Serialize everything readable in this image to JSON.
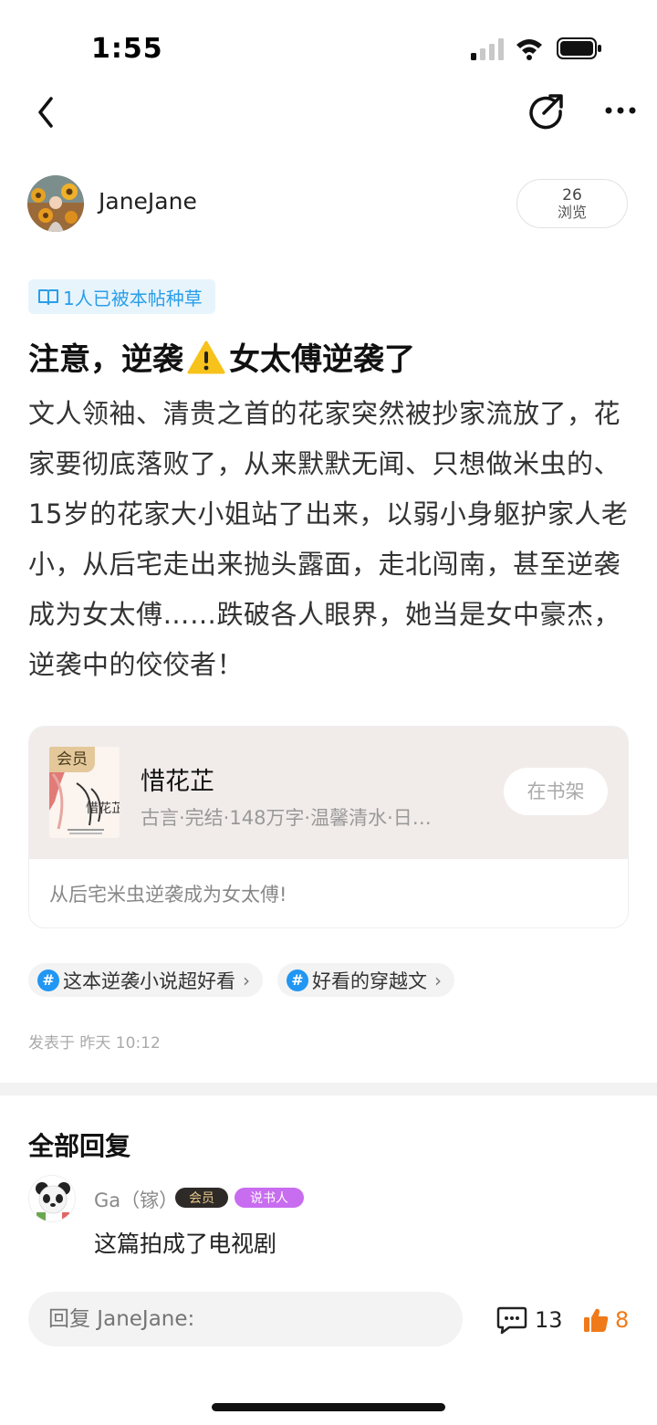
{
  "status_bar": {
    "time": "1:55"
  },
  "author": {
    "name": "JaneJane",
    "views_count": "26",
    "views_label": "浏览"
  },
  "seed_badge": {
    "text": "1人已被本帖种草",
    "icon": "book-icon"
  },
  "post": {
    "title_part1": "注意，逆袭",
    "title_part2": "女太傅逆袭了",
    "body": "文人领袖、清贵之首的花家突然被抄家流放了，花家要彻底落败了，从来默默无闻、只想做米虫的、15岁的花家大小姐站了出来，以弱小身躯护家人老小，从后宅走出来抛头露面，走北闯南，甚至逆袭成为女太傅……跌破各人眼界，她当是女中豪杰，逆袭中的佼佼者！"
  },
  "book": {
    "vip_label": "会员",
    "title": "惜花芷",
    "meta": "古言·完结·148万字·温馨清水·日…",
    "shelf_label": "在书架",
    "quote": "从后宅米虫逆袭成为女太傅!",
    "cover_title": "惜花芷"
  },
  "topics": [
    {
      "label": "这本逆袭小说超好看"
    },
    {
      "label": "好看的穿越文"
    }
  ],
  "topic_hash": "#",
  "topic_chevron": "›",
  "post_time": "发表于 昨天 10:12",
  "replies": {
    "heading": "全部回复",
    "items": [
      {
        "author": "Ga（镓）",
        "member_badge": "会员",
        "storyteller_badge": "说书人",
        "text": "这篇拍成了电视剧"
      }
    ]
  },
  "bottom_bar": {
    "reply_placeholder": "回复 JaneJane:",
    "comment_count": "13",
    "like_count": "8"
  },
  "colors": {
    "accent_blue": "#2a9ee8",
    "like_orange": "#f07a1a",
    "storyteller_purple": "#c86cf0",
    "vip_gold": "#e4c89a"
  }
}
